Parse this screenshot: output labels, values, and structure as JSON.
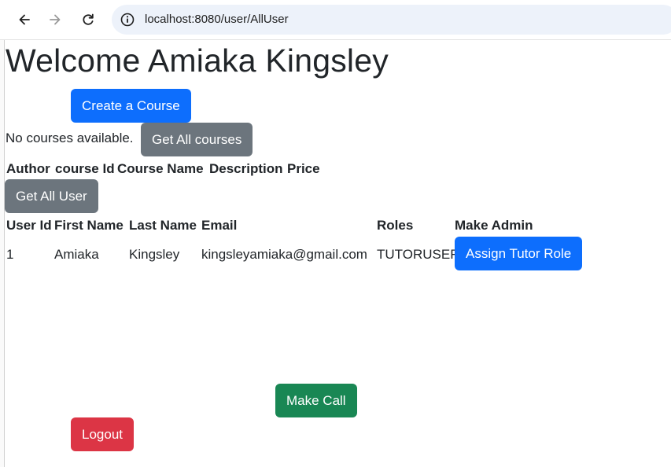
{
  "browser": {
    "url": "localhost:8080/user/AllUser"
  },
  "page": {
    "welcome": "Welcome Amiaka Kingsley",
    "create_course_label": "Create a Course",
    "no_courses_text": "No courses available.",
    "get_all_courses_label": "Get All courses",
    "course_table": {
      "headers": [
        "Author",
        "course Id",
        "Course Name",
        "Description",
        "Price"
      ]
    },
    "get_all_user_label": "Get All User",
    "user_table": {
      "headers": [
        "User Id",
        "First Name",
        "Last Name",
        "Email",
        "Roles",
        "Make Admin"
      ],
      "rows": [
        {
          "id": "1",
          "first_name": "Amiaka",
          "last_name": "Kingsley",
          "email": "kingsleyamiaka@gmail.com",
          "roles": "TUTORUSER",
          "action_label": "Assign Tutor Role"
        }
      ]
    },
    "make_call_label": "Make Call",
    "logout_label": "Logout"
  },
  "colors": {
    "primary": "#0d6efd",
    "secondary": "#6c757d",
    "success": "#198754",
    "danger": "#dc3545"
  }
}
